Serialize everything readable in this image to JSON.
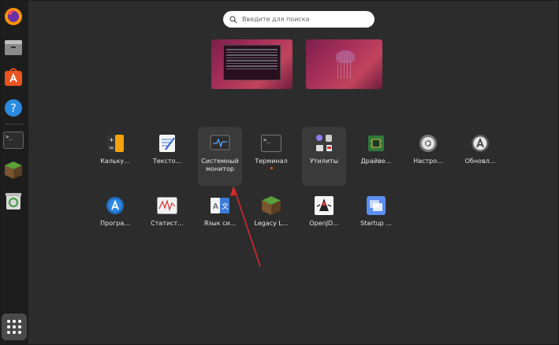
{
  "search": {
    "placeholder": "Введите для поиска"
  },
  "dock": {
    "items": [
      {
        "name": "firefox"
      },
      {
        "name": "files"
      },
      {
        "name": "software"
      },
      {
        "name": "help"
      },
      {
        "name": "terminal"
      },
      {
        "name": "minecraft"
      },
      {
        "name": "trash"
      }
    ]
  },
  "apps": {
    "row1": [
      {
        "label": "Кальку..."
      },
      {
        "label": "Тексто..."
      },
      {
        "label": "Системный монитор"
      },
      {
        "label": "Терминал"
      },
      {
        "label": "Утилиты"
      },
      {
        "label": "Драйве..."
      },
      {
        "label": "Настро..."
      },
      {
        "label": "Обновл..."
      }
    ],
    "row2": [
      {
        "label": "Програ..."
      },
      {
        "label": "Статист..."
      },
      {
        "label": "Язык си..."
      },
      {
        "label": "Legacy L..."
      },
      {
        "label": "OpenJD..."
      },
      {
        "label": "Startup ..."
      }
    ]
  },
  "colors": {
    "accent": "#e95420",
    "arrow": "#d9262e",
    "background": "#2c2c2c",
    "dock": "#1d1d1d"
  }
}
